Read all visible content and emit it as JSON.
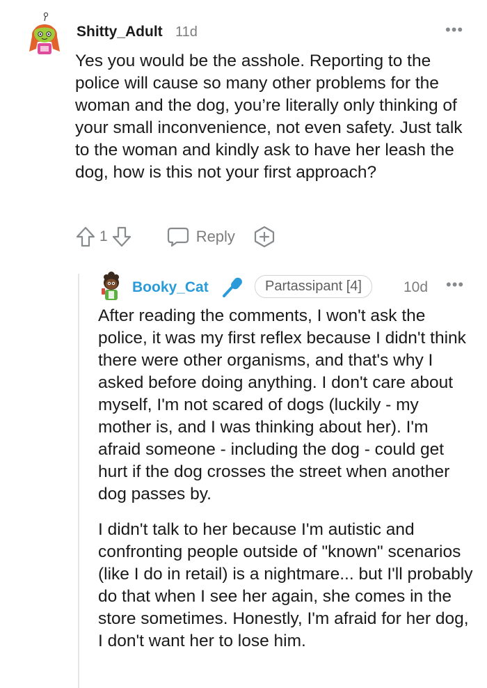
{
  "comment": {
    "username": "Shitty_Adult",
    "time": "11d",
    "more": "•••",
    "body": "Yes you would be the asshole. Reporting to the police will cause so many other problems for the woman and the dog, you’re literally only thinking of your small inconvenience, not even safety. Just talk to the woman and kindly ask to have her leash the dog, how is this not your first approach?",
    "score": "1",
    "reply_label": "Reply",
    "icons": [
      "upvote-icon",
      "downvote-icon",
      "comment-bubble-icon",
      "award-plus-icon"
    ]
  },
  "reply": {
    "username": "Booky_Cat",
    "flair": "Partassipant [4]",
    "time": "10d",
    "more": "•••",
    "paragraphs": [
      "After reading the comments, I won't ask the police, it was my first reflex because I didn't think there were other organisms, and that's why I asked before doing anything. I don't care about myself, I'm not scared of dogs (luckily - my mother is, and I was thinking about her). I'm afraid someone - including the dog - could get hurt if the dog crosses the street when another dog passes by.",
      "I didn't talk to her because I'm autistic and confronting people outside of \"known\" scenarios (like I do in retail) is a nightmare... but I'll probably do that when I see her again, she comes in the store sometimes. Honestly, I'm afraid for her dog, I don't want her to lose him."
    ]
  },
  "colors": {
    "reply_username": "#2a9bd8",
    "meta_gray": "#7c7c7c",
    "text": "#1a1a1b"
  }
}
